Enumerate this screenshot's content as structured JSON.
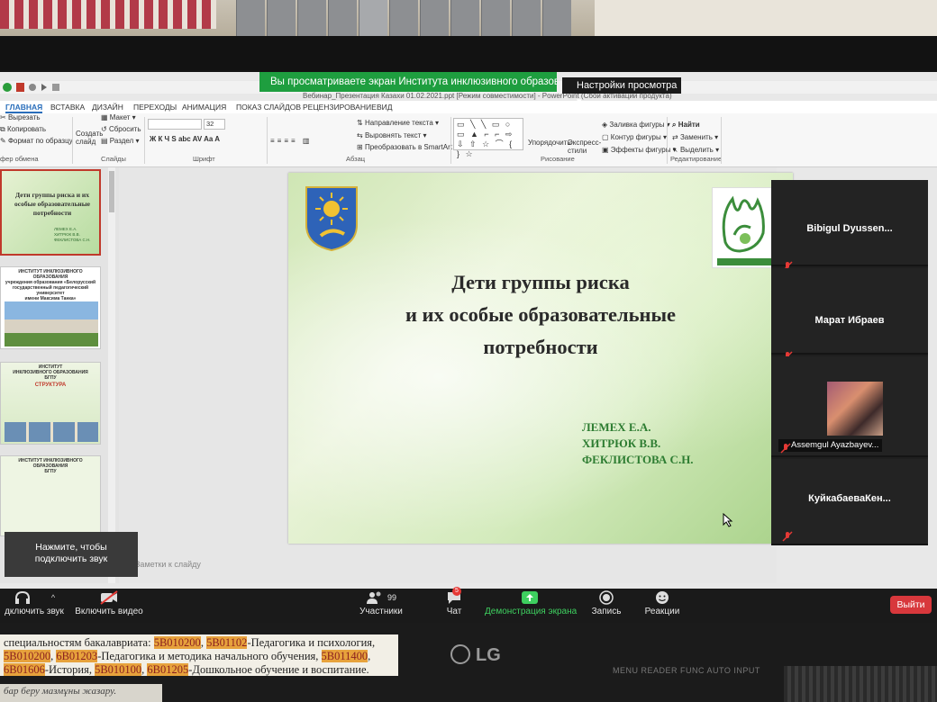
{
  "zoom": {
    "share_banner": "Вы просматриваете экран Института инклюзивного образова...",
    "view_settings": "Настройки просмотра",
    "unmute_toast": [
      "Нажмите, чтобы",
      "подключить звук"
    ],
    "toolbar": {
      "audio": "дключить звук",
      "video": "Включить видео",
      "participants": "Участники",
      "participants_count": "99",
      "chat": "Чат",
      "chat_badge": "5",
      "share": "Демонстрация экрана",
      "record": "Запись",
      "reactions": "Реакции",
      "exit": "Выйти"
    },
    "participants": [
      {
        "name": "Bibigul  Dyussen...",
        "muted": true
      },
      {
        "name": "Марат Ибраев",
        "muted": true
      },
      {
        "name": "Assemgul Ayazbayev...",
        "muted": true,
        "has_video": true
      },
      {
        "name": "КуйкабаеваКен...",
        "muted": true
      }
    ]
  },
  "powerpoint": {
    "doc_title": "Вебинар_Презентация Казахи 01.02.2021.ppt [Режим совместимости] - PowerPoint (Сбой активации продукта)",
    "tabs": [
      "ГЛАВНАЯ",
      "ВСТАВКА",
      "ДИЗАЙН",
      "ПЕРЕХОДЫ",
      "АНИМАЦИЯ",
      "ПОКАЗ СЛАЙДОВ",
      "РЕЦЕНЗИРОВАНИЕ",
      "ВИД"
    ],
    "ribbon": {
      "clipboard": {
        "cut": "Вырезать",
        "copy": "Копировать",
        "format_painter": "Формат по образцу",
        "label": "фер обмена"
      },
      "slides": {
        "new_slide": "Создать слайд",
        "layout": "Макет",
        "reset": "Сбросить",
        "section": "Раздел",
        "label": "Слайды"
      },
      "font": {
        "size": "32",
        "label": "Шрифт",
        "buttons": "Ж  К  Ч  S  abc  AV  Aa  A"
      },
      "paragraph": {
        "direction": "Направление текста",
        "align": "Выровнять текст",
        "smartart": "Преобразовать в SmartArt",
        "label": "Абзац"
      },
      "drawing": {
        "arrange": "Упорядочить",
        "quick_styles": "Экспресс-стили",
        "fill": "Заливка фигуры",
        "outline": "Контур фигуры",
        "effects": "Эффекты фигуры",
        "label": "Рисование",
        "shapes": "▭ ╲ ╲ ▭ ○ ▭ ▲ ⌐ ⌐ ⇨ ⇩ ⇧ ☆ ⌒ { } ☆"
      },
      "editing": {
        "find": "Найти",
        "replace": "Заменить",
        "select": "Выделить",
        "label": "Редактирование"
      }
    },
    "notes_placeholder": "Заметки к слайду"
  },
  "thumbnails": [
    {
      "title": "Дети группы риска и их особые образовательные потребности",
      "authors": [
        "ЛЕМЕХ Е.А.",
        "ХИТРЮК В.В.",
        "ФЕКЛИСТОВА С.Н."
      ]
    },
    {
      "header": [
        "ИНСТИТУТ ИНКЛЮЗИВНОГО ОБРАЗОВАНИЯ",
        "учреждения образования «Белорусский",
        "государственный педагогический университет",
        "имени Максима Танка»"
      ]
    },
    {
      "header": [
        "ИНСТИТУТ",
        "ИНКЛЮЗИВНОГО ОБРАЗОВАНИЯ",
        "БГПУ"
      ],
      "subtitle": "СТРУКТУРА"
    },
    {
      "header": [
        "ИНСТИТУТ ИНКЛЮЗИВНОГО ОБРАЗОВАНИЯ",
        "БГПУ"
      ]
    }
  ],
  "slide": {
    "title_lines": [
      "Дети группы риска",
      "и их особые образовательные",
      "потребности"
    ],
    "authors": [
      "ЛЕМЕХ Е.А.",
      "ХИТРЮК В.В.",
      "ФЕКЛИСТОВА С.Н."
    ]
  },
  "paper_note": {
    "line1_a": "специальностям бакалавриата: ",
    "line1_hl1": "5В010200",
    "line1_b": ", ",
    "line1_hl2": "5В01102",
    "line1_c": "-Педагогика и психология,",
    "line2_hl1": "5В010200",
    "line2_a": ", ",
    "line2_hl2": "6В01203",
    "line2_b": "-Педагогика и методика начального обучения, ",
    "line2_hl3": "5В011400",
    "line2_c": ",",
    "line3_hl1": "6В01606",
    "line3_a": "-История, ",
    "line3_hl2": "5В010100",
    "line3_b": ", ",
    "line3_hl3": "6В01205",
    "line3_c": "-Дошкольное обучение и воспитание.",
    "lower": "бар беру мазмұны жазару."
  },
  "monitor": {
    "brand": "LG",
    "buttons": "MENU   READER   FUNC   AUTO   INPUT"
  }
}
